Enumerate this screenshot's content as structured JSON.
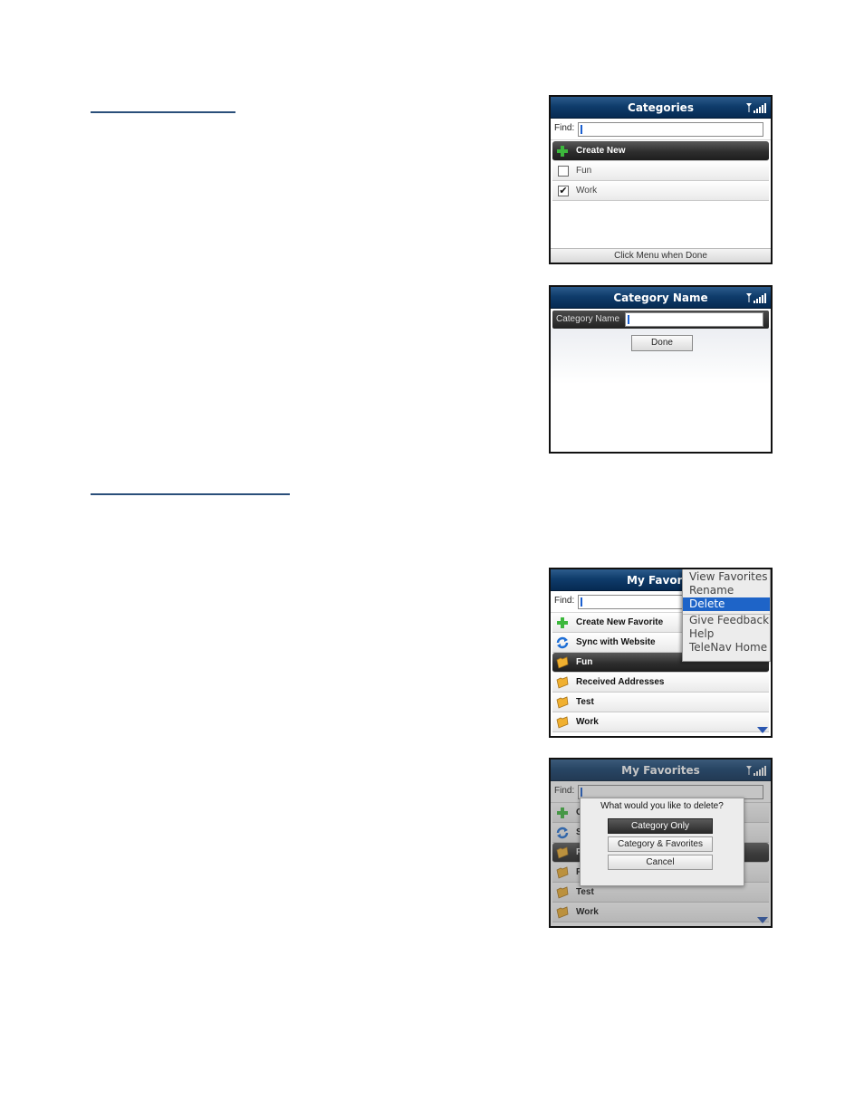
{
  "screen1": {
    "title": "Categories",
    "find_label": "Find:",
    "items": [
      {
        "label": "Create New",
        "icon": "plus-icon",
        "selected": true
      },
      {
        "label": "Fun",
        "checked": false
      },
      {
        "label": "Work",
        "checked": true
      }
    ],
    "status": "Click Menu when Done"
  },
  "screen2": {
    "title": "Category Name",
    "field_label": "Category Name",
    "done_label": "Done"
  },
  "screen3": {
    "title": "My Favorit",
    "find_label": "Find:",
    "items": [
      {
        "label": "Create New Favorite",
        "icon": "plus-icon"
      },
      {
        "label": "Sync with Website",
        "icon": "sync-icon"
      },
      {
        "label": "Fun",
        "icon": "folder-icon",
        "selected": true
      },
      {
        "label": "Received Addresses",
        "icon": "folder-icon"
      },
      {
        "label": "Test",
        "icon": "folder-icon"
      },
      {
        "label": "Work",
        "icon": "folder-icon"
      }
    ],
    "menu": [
      "View Favorites",
      "Rename",
      "Delete",
      "Give Feedback",
      "Help",
      "TeleNav Home"
    ],
    "menu_highlighted": "Delete"
  },
  "screen4": {
    "title": "My Favorites",
    "find_label": "Find:",
    "visible_items": [
      {
        "label": "C",
        "icon": "plus-icon"
      },
      {
        "label": "S",
        "icon": "sync-icon"
      },
      {
        "label": "F",
        "icon": "folder-icon",
        "selected": true
      },
      {
        "label": "F",
        "icon": "folder-icon"
      },
      {
        "label": "Test",
        "icon": "folder-icon"
      },
      {
        "label": "Work",
        "icon": "folder-icon"
      }
    ],
    "dialog": {
      "title": "What would you like to delete?",
      "options": [
        "Category Only",
        "Category & Favorites",
        "Cancel"
      ],
      "selected": "Category Only"
    }
  },
  "colors": {
    "titlebar": "#0f3c6b",
    "highlight": "#1e64c8",
    "selected_row": "#2e2e2e",
    "link_underline": "#2a4f7a"
  }
}
